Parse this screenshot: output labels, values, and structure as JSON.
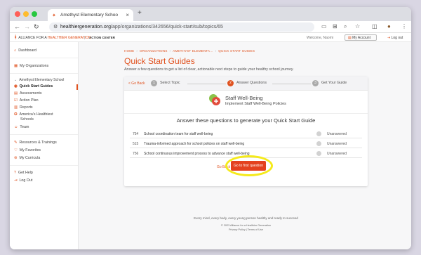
{
  "browser": {
    "tab_title": "Amethyst Elementary Schoo",
    "new_tab": "+",
    "url_host": "healthiergeneration.org",
    "url_path": "/app/organizations/342656/quick-start/sub/topics/65"
  },
  "site": {
    "logo_text": "ALLIANCE FOR A",
    "logo_highlight": "HEALTHIER GENERATION",
    "action_center": "ACTION CENTER",
    "welcome": "Welcome, Naomi",
    "my_account": "My Account",
    "logout": "Log out"
  },
  "sidebar": {
    "dashboard": "Dashboard",
    "my_orgs": "My Organizations",
    "school": "Amethyst Elementary School",
    "quick_start": "Quick Start Guides",
    "assessments": "Assessments",
    "action_plan": "Action Plan",
    "reports": "Reports",
    "healthiest": "America's Healthiest",
    "healthiest2": "Schools",
    "team": "Team",
    "resources": "Resources & Trainings",
    "favorites": "My Favorites",
    "curricula": "My Curricula",
    "help": "Get Help",
    "logout": "Log Out"
  },
  "breadcrumb": {
    "home": "HOME",
    "orgs": "ORGANIZATIONS",
    "school": "AMETHYST ELEMENTA...",
    "current": "QUICK START GUIDES"
  },
  "page": {
    "title": "Quick Start Guides",
    "subtitle": "Answer a few questions to get a list of clear, actionable next steps to guide your healthy school journey."
  },
  "steps": {
    "go_back": "< Go Back",
    "s1_num": "1",
    "s1": "Select Topic",
    "s2_num": "2",
    "s2": "Answer Questions",
    "s3_num": "3",
    "s3": "Get Your Guide"
  },
  "topic": {
    "name": "Staff Well-Being",
    "policy": "Implement Staff Well-Being Policies"
  },
  "questions_heading": "Answer these questions to generate your Quick Start Guide",
  "questions": [
    {
      "num": "754",
      "text": "School coordination team for staff well-being",
      "status": "Unanswered"
    },
    {
      "num": "515",
      "text": "Trauma-informed approach for school policies on staff well-being",
      "status": "Unanswered"
    },
    {
      "num": "756",
      "text": "School continuous improvement process to advance staff well-being",
      "status": "Unanswered"
    }
  ],
  "actions": {
    "go_back": "Go Back",
    "go_first": "Go to first question"
  },
  "footer": {
    "tagline": "Every mind, every body, every young person healthy and ready to succeed",
    "copyright": "© 2023 Alliance for a Healthier Generation",
    "links": "Privacy Policy | Terms of Use"
  },
  "colors": {
    "accent": "#e0521f",
    "highlight": "#f5ea1b"
  }
}
